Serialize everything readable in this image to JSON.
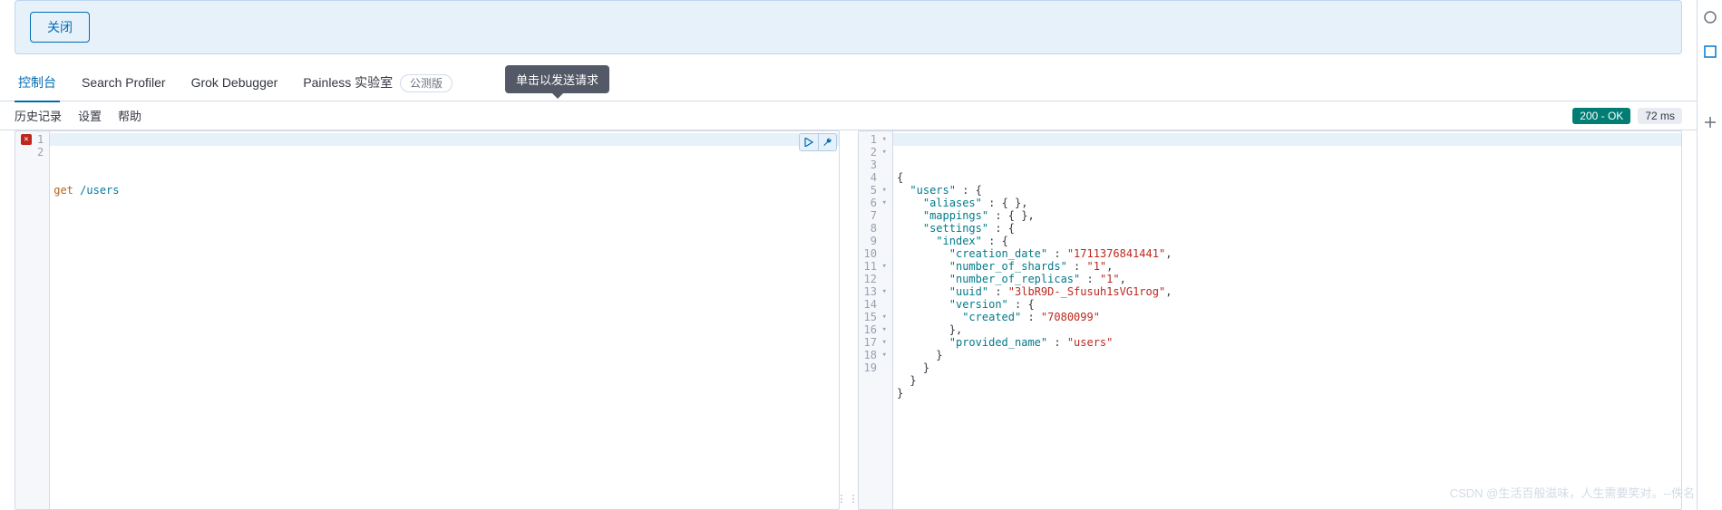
{
  "banner": {
    "close_btn": "关闭"
  },
  "tabs": {
    "console": "控制台",
    "profiler": "Search Profiler",
    "grok": "Grok Debugger",
    "painless": "Painless 实验室",
    "badge": "公测版"
  },
  "subtabs": {
    "history": "历史记录",
    "settings": "设置",
    "help": "帮助"
  },
  "status": {
    "code": "200 - OK",
    "time": "72 ms"
  },
  "tooltip": "单击以发送请求",
  "request": {
    "lines": [
      {
        "n": "1",
        "method": "get",
        "path": "/users",
        "err": true
      },
      {
        "n": "2"
      }
    ]
  },
  "response": {
    "lines": [
      {
        "n": "1",
        "fold": true,
        "txt_raw": "{",
        "indent": 0
      },
      {
        "n": "2",
        "fold": true,
        "indent": 1,
        "prop": "users",
        "after": " : {"
      },
      {
        "n": "3",
        "indent": 2,
        "prop": "aliases",
        "after": " : { },"
      },
      {
        "n": "4",
        "indent": 2,
        "prop": "mappings",
        "after": " : { },"
      },
      {
        "n": "5",
        "fold": true,
        "indent": 2,
        "prop": "settings",
        "after": " : {"
      },
      {
        "n": "6",
        "fold": true,
        "indent": 3,
        "prop": "index",
        "after": " : {"
      },
      {
        "n": "7",
        "indent": 4,
        "prop": "creation_date",
        "val": "1711376841441",
        "comma": true
      },
      {
        "n": "8",
        "indent": 4,
        "prop": "number_of_shards",
        "val": "1",
        "comma": true
      },
      {
        "n": "9",
        "indent": 4,
        "prop": "number_of_replicas",
        "val": "1",
        "comma": true
      },
      {
        "n": "10",
        "indent": 4,
        "prop": "uuid",
        "val": "3lbR9D-_Sfusuh1sVG1rog",
        "comma": true
      },
      {
        "n": "11",
        "fold": true,
        "indent": 4,
        "prop": "version",
        "after": " : {"
      },
      {
        "n": "12",
        "indent": 5,
        "prop": "created",
        "val": "7080099"
      },
      {
        "n": "13",
        "fold": true,
        "indent": 4,
        "txt_raw": "},"
      },
      {
        "n": "14",
        "indent": 4,
        "prop": "provided_name",
        "val": "users"
      },
      {
        "n": "15",
        "fold": true,
        "indent": 3,
        "txt_raw": "}"
      },
      {
        "n": "16",
        "fold": true,
        "indent": 2,
        "txt_raw": "}"
      },
      {
        "n": "17",
        "fold": true,
        "indent": 1,
        "txt_raw": "}"
      },
      {
        "n": "18",
        "fold": true,
        "indent": 0,
        "txt_raw": "}"
      },
      {
        "n": "19"
      }
    ]
  },
  "watermark": "CSDN @生活百般滋味，人生需要笑对。--佚名"
}
